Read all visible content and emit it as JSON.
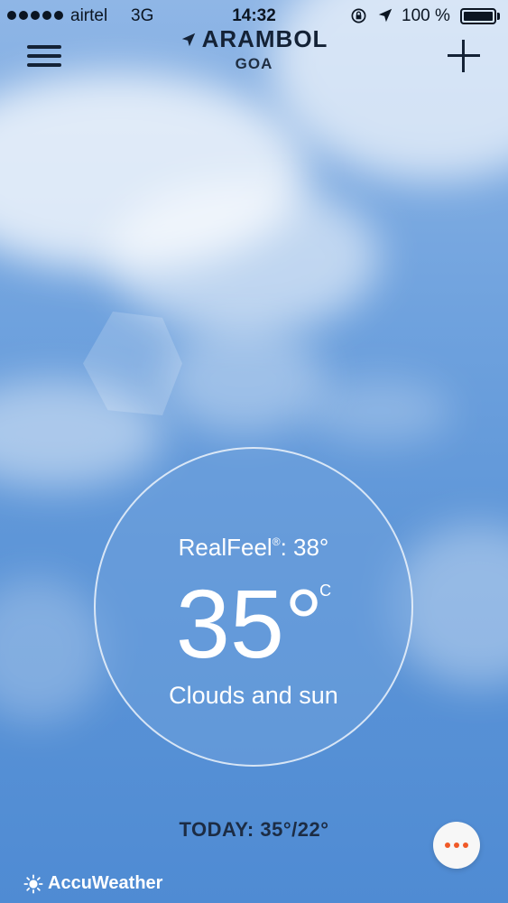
{
  "status_bar": {
    "carrier": "airtel",
    "network": "3G",
    "time": "14:32",
    "battery": "100 %"
  },
  "location": {
    "city": "ARAMBOL",
    "region": "GOA"
  },
  "current": {
    "realfeel_label": "RealFeel",
    "realfeel_value": ": 38°",
    "temperature": "35°",
    "unit": "C",
    "condition": "Clouds and sun"
  },
  "today": "TODAY: 35°/22°",
  "brand": "AccuWeather",
  "icons": [
    "menu-icon",
    "add-icon",
    "location-arrow-icon",
    "rotation-lock-icon",
    "more-icon",
    "accuweather-sun-icon"
  ],
  "colors": {
    "accent": "#f05a28",
    "text_dark": "#142236",
    "sky": "#6fa2de"
  }
}
